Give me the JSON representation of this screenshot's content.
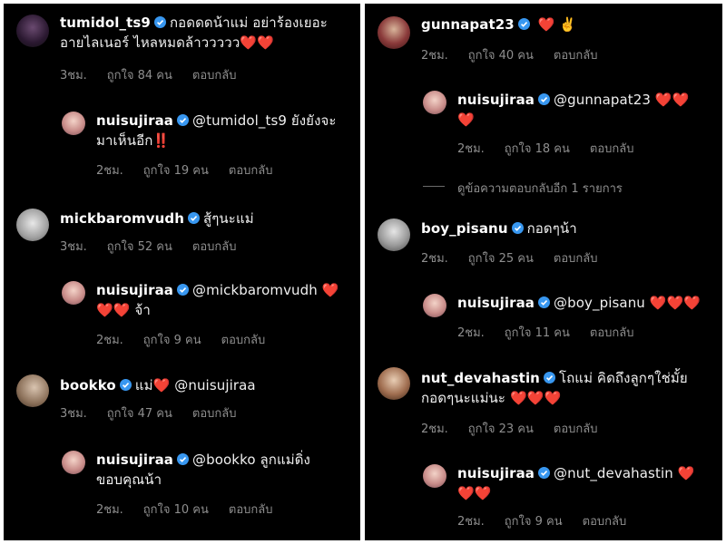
{
  "badge_color": "#3897f0",
  "heart_color": "#ed1c24",
  "left": {
    "comments": [
      {
        "user": "tumidol_ts9",
        "text_line1": "กอดดดน้าแม่ อย่าร้องเยอะ",
        "text_line2": "อายไลเนอร์ ไหลหมดล้าววววว",
        "time": "3ชม.",
        "likes": "ถูกใจ 84 คน",
        "reply": "ตอบกลับ"
      },
      {
        "user": "nuisujiraa",
        "text_line1": "@tumidol_ts9 ยังยังจะ",
        "text_line2": "มาเห็นอีก",
        "emoji": "‼️",
        "time": "2ชม.",
        "likes": "ถูกใจ 19 คน",
        "reply": "ตอบกลับ"
      },
      {
        "user": "mickbaromvudh",
        "text_line1": "สู้ๆนะแม่",
        "time": "3ชม.",
        "likes": "ถูกใจ 52 คน",
        "reply": "ตอบกลับ"
      },
      {
        "user": "nuisujiraa",
        "text_line1": "@mickbaromvudh",
        "text_line2": "จ้า",
        "time": "2ชม.",
        "likes": "ถูกใจ 9 คน",
        "reply": "ตอบกลับ"
      },
      {
        "user": "bookko",
        "text_line1": "แม่",
        "text_tail": "@nuisujiraa",
        "time": "3ชม.",
        "likes": "ถูกใจ 47 คน",
        "reply": "ตอบกลับ"
      },
      {
        "user": "nuisujiraa",
        "text_line1": "@bookko ลูกแม่ดิ่ง",
        "text_line2": "ขอบคุณน้า",
        "time": "2ชม.",
        "likes": "ถูกใจ 10 คน",
        "reply": "ตอบกลับ"
      }
    ]
  },
  "right": {
    "comments": [
      {
        "user": "gunnapat23",
        "emoji": "✌️",
        "time": "2ชม.",
        "likes": "ถูกใจ 40 คน",
        "reply": "ตอบกลับ"
      },
      {
        "user": "nuisujiraa",
        "text_line1": "@gunnapat23",
        "time": "2ชม.",
        "likes": "ถูกใจ 18 คน",
        "reply": "ตอบกลับ"
      },
      {
        "user": "boy_pisanu",
        "text_line1": "กอดๆน้า",
        "time": "2ชม.",
        "likes": "ถูกใจ 25 คน",
        "reply": "ตอบกลับ"
      },
      {
        "user": "nuisujiraa",
        "text_line1": "@boy_pisanu",
        "time": "2ชม.",
        "likes": "ถูกใจ 11 คน",
        "reply": "ตอบกลับ"
      },
      {
        "user": "nut_devahastin",
        "text_line1": "โถแม่ คิดถึงลูกๆใช่มั้ย",
        "text_line2": "กอดๆนะแม่นะ",
        "time": "2ชม.",
        "likes": "ถูกใจ 23 คน",
        "reply": "ตอบกลับ"
      },
      {
        "user": "nuisujiraa",
        "text_line1": "@nut_devahastin",
        "time": "2ชม.",
        "likes": "ถูกใจ 9 คน",
        "reply": "ตอบกลับ"
      }
    ],
    "view_more_replies": "ดูข้อความตอบกลับอีก 1 รายการ"
  },
  "icons": {
    "verified": "verified-badge-icon",
    "heart": "heart-icon",
    "avatar": "avatar"
  }
}
